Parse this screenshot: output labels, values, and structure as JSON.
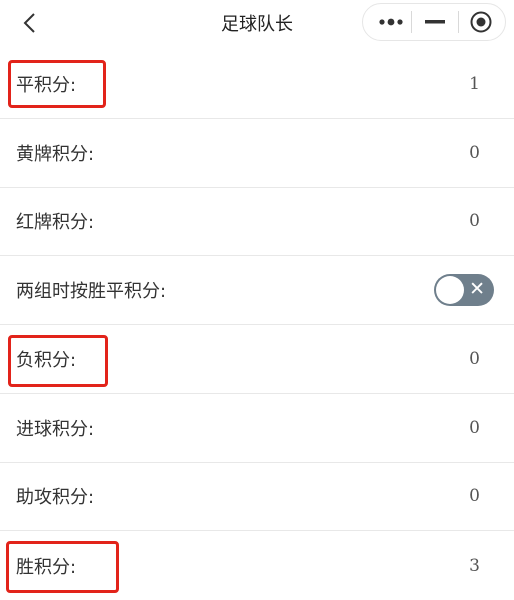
{
  "nav": {
    "title": "足球队长",
    "more_icon": "more-dots-icon",
    "minimize_icon": "minus-icon",
    "close_icon": "target-circle-icon",
    "back_icon": "chevron-left-icon"
  },
  "rows": [
    {
      "label": "平积分:",
      "value": "1",
      "highlighted": true
    },
    {
      "label": "黄牌积分:",
      "value": "0",
      "highlighted": false
    },
    {
      "label": "红牌积分:",
      "value": "0",
      "highlighted": false
    },
    {
      "label": "两组时按胜平积分:",
      "toggle_on": false,
      "highlighted": false
    },
    {
      "label": "负积分:",
      "value": "0",
      "highlighted": true
    },
    {
      "label": "进球积分:",
      "value": "0",
      "highlighted": false
    },
    {
      "label": "助攻积分:",
      "value": "0",
      "highlighted": false
    },
    {
      "label": "胜积分:",
      "value": "3",
      "highlighted": true
    }
  ],
  "colors": {
    "highlight": "#e2231a",
    "toggle_off": "#6f7f8c"
  }
}
